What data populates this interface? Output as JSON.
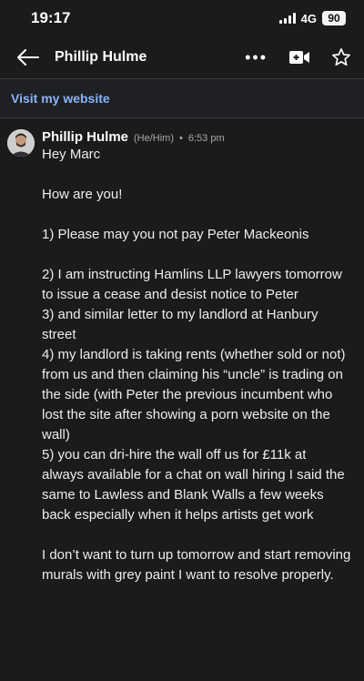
{
  "status": {
    "time": "19:17",
    "network": "4G",
    "battery": "90"
  },
  "header": {
    "contact_name": "Phillip Hulme"
  },
  "website": {
    "label": "Visit my website"
  },
  "message": {
    "sender": "Phillip Hulme",
    "pronouns": "(He/Him)",
    "separator": "•",
    "time": "6:53 pm",
    "lines": [
      "Hey Marc",
      "",
      "How are you!",
      "",
      "1) Please may you not pay Peter Mackeonis",
      "",
      "2) I am instructing Hamlins LLP lawyers tomorrow to issue a cease and desist notice to Peter",
      "3) and similar letter to my landlord at Hanbury street",
      "4) my landlord is taking rents (whether sold or not) from us and then claiming his “uncle” is trading on the side (with Peter the previous incumbent who lost the site after showing a porn website on the wall)",
      "5) you can dri-hire the wall off us for £11k at always available for a chat on wall hiring I said the same to Lawless and Blank Walls a few weeks back especially when it helps artists get work",
      "",
      "I don’t want to turn up tomorrow and start removing murals with grey paint I want to resolve properly."
    ]
  }
}
